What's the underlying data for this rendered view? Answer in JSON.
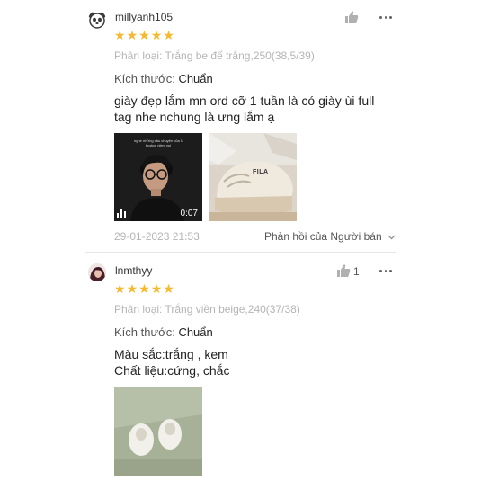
{
  "reviews": [
    {
      "username": "millyanh105",
      "rating_stars": 5,
      "variant": "Phân loại: Trắng be đế trắng,250(38,5/39)",
      "size_label": "Kích thước:",
      "size_value": "Chuẩn",
      "comment_lines": [
        "giày đẹp lắm mn ord cỡ 1 tuần là có giày ùi full",
        "tag nhe nchung là ưng lắm ạ"
      ],
      "video_caption": "nghe những câu chuyện của 1 thoáng niềm vui",
      "video_duration": "0:07",
      "photo_brand": "FILA",
      "date": "29-01-2023 21:53",
      "reply_label": "Phản hồi của Người bán",
      "like_count": ""
    },
    {
      "username": "lnmthyy",
      "rating_stars": 5,
      "variant": "Phân loại: Trắng viền beige,240(37/38)",
      "size_label": "Kích thước:",
      "size_value": "Chuẩn",
      "comment_lines": [
        "Màu sắc:trắng , kem",
        "Chất liệu:cứng, chắc"
      ],
      "like_count": "1"
    }
  ],
  "colors": {
    "star": "#f5b82e",
    "muted": "#b5b5b5"
  },
  "icons": [
    "avatar-bear-icon",
    "thumbs-up-icon",
    "more-dots-icon",
    "chevron-down-icon",
    "video-bars-icon",
    "star-icon"
  ]
}
